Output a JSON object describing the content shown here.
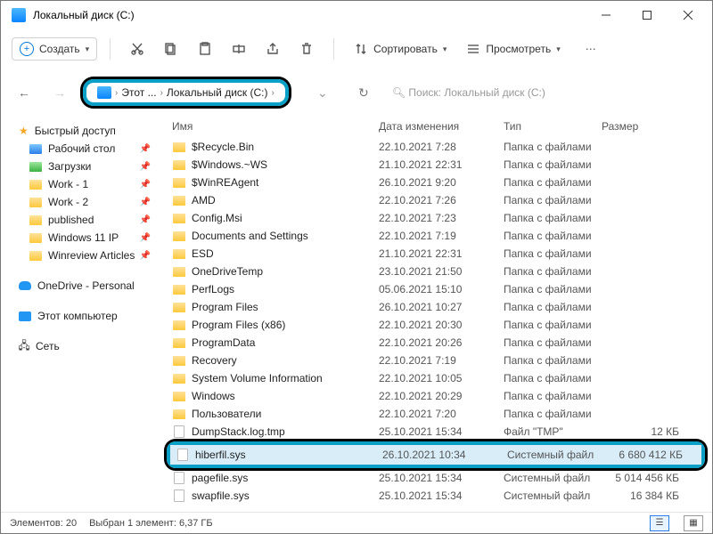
{
  "window": {
    "title": "Локальный диск (C:)"
  },
  "toolbar": {
    "create": "Создать",
    "sort": "Сортировать",
    "view": "Просмотреть"
  },
  "breadcrumb": {
    "root": "Этот ...",
    "disk": "Локальный диск (C:)"
  },
  "search": {
    "placeholder": "Поиск: Локальный диск (C:)"
  },
  "sidebar": {
    "quick": "Быстрый доступ",
    "items": [
      {
        "label": "Рабочий стол",
        "icon": "blue",
        "pin": true
      },
      {
        "label": "Загрузки",
        "icon": "green",
        "pin": true
      },
      {
        "label": "Work - 1",
        "icon": "folder",
        "pin": true
      },
      {
        "label": "Work - 2",
        "icon": "folder",
        "pin": true
      },
      {
        "label": "published",
        "icon": "folder",
        "pin": true
      },
      {
        "label": "Windows 11 IP",
        "icon": "folder",
        "pin": true
      },
      {
        "label": "Winreview Articles",
        "icon": "folder",
        "pin": true
      }
    ],
    "onedrive": "OneDrive - Personal",
    "thispc": "Этот компьютер",
    "network": "Сеть"
  },
  "columns": {
    "name": "Имя",
    "date": "Дата изменения",
    "type": "Тип",
    "size": "Размер"
  },
  "files": [
    {
      "name": "$Recycle.Bin",
      "date": "22.10.2021 7:28",
      "type": "Папка с файлами",
      "size": "",
      "kind": "folder"
    },
    {
      "name": "$Windows.~WS",
      "date": "21.10.2021 22:31",
      "type": "Папка с файлами",
      "size": "",
      "kind": "folder"
    },
    {
      "name": "$WinREAgent",
      "date": "26.10.2021 9:20",
      "type": "Папка с файлами",
      "size": "",
      "kind": "folder"
    },
    {
      "name": "AMD",
      "date": "22.10.2021 7:26",
      "type": "Папка с файлами",
      "size": "",
      "kind": "folder"
    },
    {
      "name": "Config.Msi",
      "date": "22.10.2021 7:23",
      "type": "Папка с файлами",
      "size": "",
      "kind": "folder"
    },
    {
      "name": "Documents and Settings",
      "date": "22.10.2021 7:19",
      "type": "Папка с файлами",
      "size": "",
      "kind": "folder"
    },
    {
      "name": "ESD",
      "date": "21.10.2021 22:31",
      "type": "Папка с файлами",
      "size": "",
      "kind": "folder"
    },
    {
      "name": "OneDriveTemp",
      "date": "23.10.2021 21:50",
      "type": "Папка с файлами",
      "size": "",
      "kind": "folder"
    },
    {
      "name": "PerfLogs",
      "date": "05.06.2021 15:10",
      "type": "Папка с файлами",
      "size": "",
      "kind": "folder"
    },
    {
      "name": "Program Files",
      "date": "26.10.2021 10:27",
      "type": "Папка с файлами",
      "size": "",
      "kind": "folder"
    },
    {
      "name": "Program Files (x86)",
      "date": "22.10.2021 20:30",
      "type": "Папка с файлами",
      "size": "",
      "kind": "folder"
    },
    {
      "name": "ProgramData",
      "date": "22.10.2021 20:26",
      "type": "Папка с файлами",
      "size": "",
      "kind": "folder"
    },
    {
      "name": "Recovery",
      "date": "22.10.2021 7:19",
      "type": "Папка с файлами",
      "size": "",
      "kind": "folder"
    },
    {
      "name": "System Volume Information",
      "date": "22.10.2021 10:05",
      "type": "Папка с файлами",
      "size": "",
      "kind": "folder"
    },
    {
      "name": "Windows",
      "date": "22.10.2021 20:29",
      "type": "Папка с файлами",
      "size": "",
      "kind": "folder"
    },
    {
      "name": "Пользователи",
      "date": "22.10.2021 7:20",
      "type": "Папка с файлами",
      "size": "",
      "kind": "folder"
    },
    {
      "name": "DumpStack.log.tmp",
      "date": "25.10.2021 15:34",
      "type": "Файл \"TMP\"",
      "size": "12 КБ",
      "kind": "file"
    },
    {
      "name": "hiberfil.sys",
      "date": "26.10.2021 10:34",
      "type": "Системный файл",
      "size": "6 680 412 КБ",
      "kind": "file",
      "highlight": true
    },
    {
      "name": "pagefile.sys",
      "date": "25.10.2021 15:34",
      "type": "Системный файл",
      "size": "5 014 456 КБ",
      "kind": "file"
    },
    {
      "name": "swapfile.sys",
      "date": "25.10.2021 15:34",
      "type": "Системный файл",
      "size": "16 384 КБ",
      "kind": "file"
    }
  ],
  "status": {
    "count": "Элементов: 20",
    "selection": "Выбран 1 элемент: 6,37 ГБ"
  }
}
